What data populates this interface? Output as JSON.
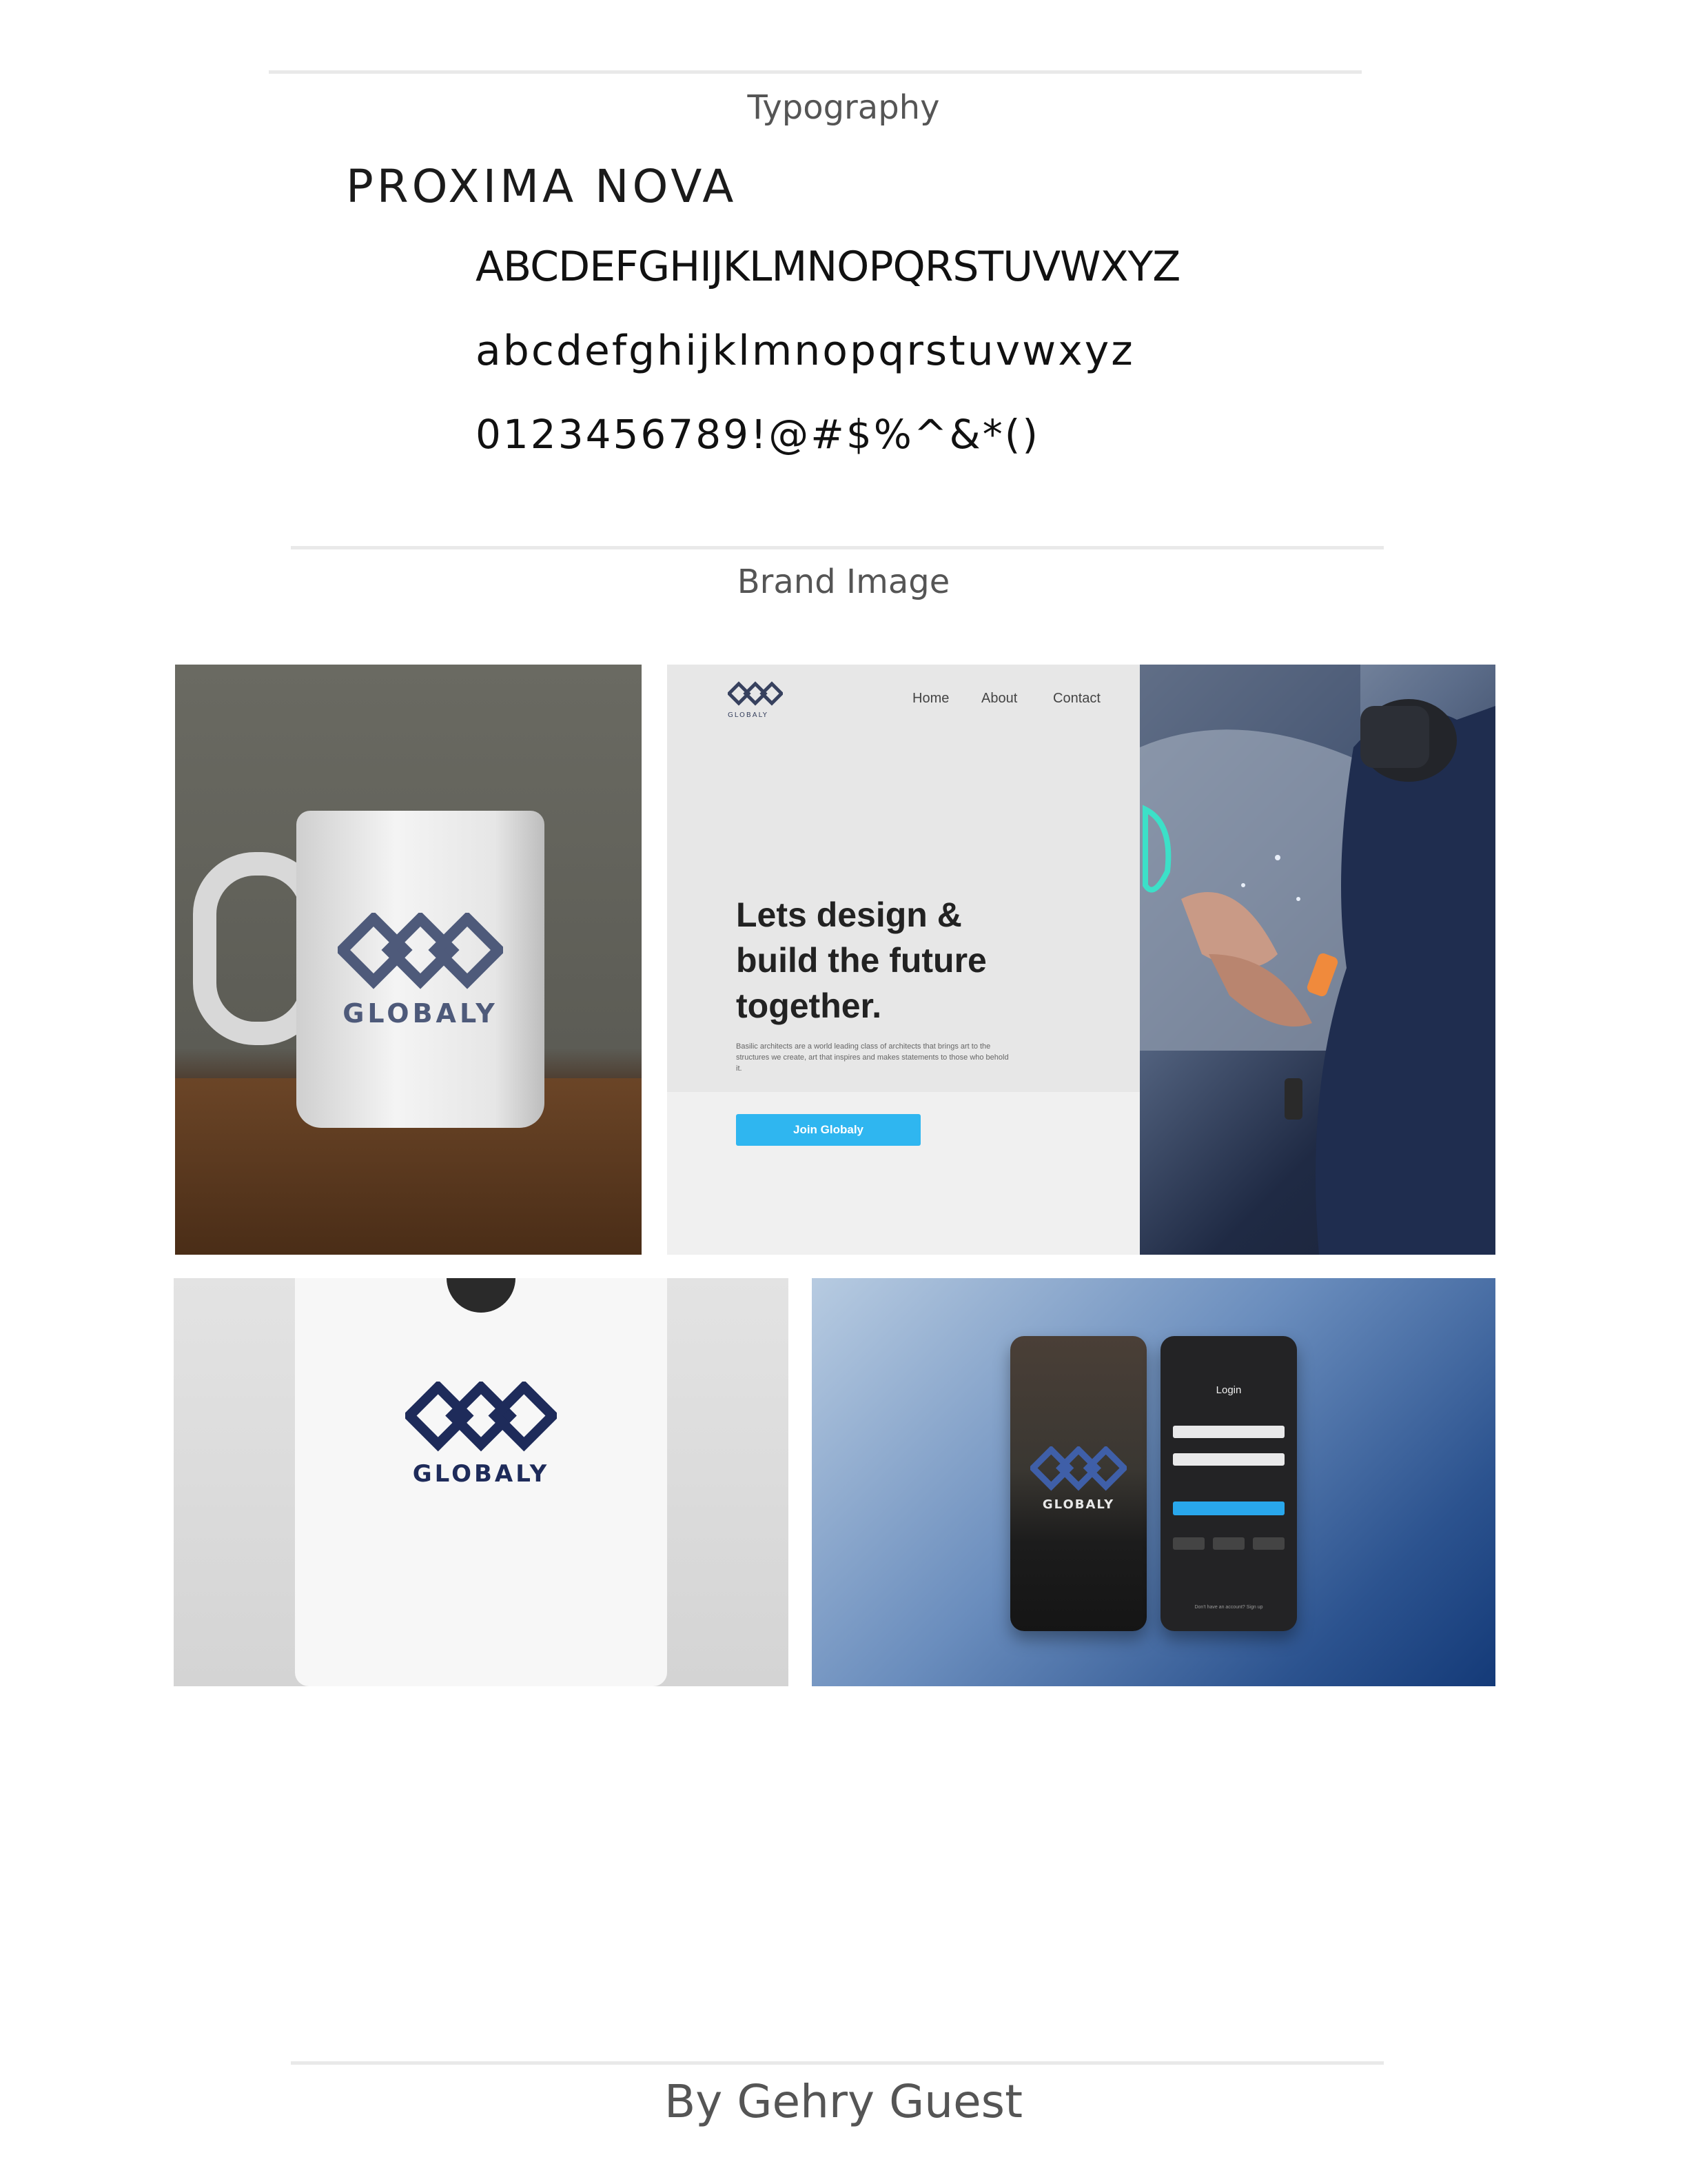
{
  "typography": {
    "section_title": "Typography",
    "font_name": "PROXIMA NOVA",
    "uppercase": "ABCDEFGHIJKLMNOPQRSTUVWXYZ",
    "lowercase": "abcdefghijklmnopqrstuvwxyz",
    "numerals_symbols": "0123456789!@#$%^&*()"
  },
  "brand_image": {
    "section_title": "Brand Image",
    "mug_logo_word": "GLOBALY",
    "website": {
      "logo_word": "GLOBALY",
      "nav": [
        "Home",
        "About",
        "Contact"
      ],
      "headline": "Lets design & build the future together.",
      "body": "Basilic architects are a world leading class of architects that brings art to the structures we create, art that inspires and makes statements to those who behold it.",
      "cta_label": "Join Globaly"
    },
    "tshirt_logo_word": "GLOBALY",
    "app": {
      "splash_logo_word": "GLOBALY",
      "login_title": "Login",
      "footer_text": "Don't have an account? Sign up"
    },
    "brand_color": "#1e2b5a",
    "accent_color": "#2fb6f0"
  },
  "footer": {
    "author": "By Gehry Guest"
  }
}
